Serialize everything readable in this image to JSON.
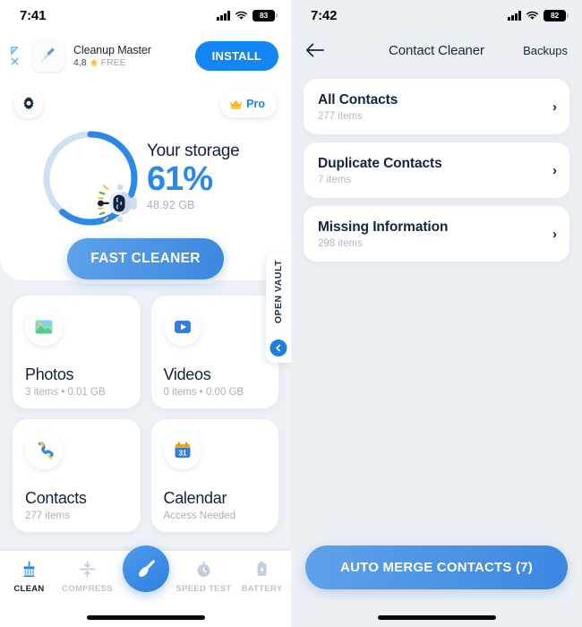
{
  "left": {
    "status": {
      "time": "7:41",
      "battery": "83",
      "signal_icon": "signal-bars-icon",
      "wifi_icon": "wifi-icon"
    },
    "ad": {
      "adchoices_icon": "adchoices-triangle-icon",
      "close_icon": "close-x-icon",
      "app_icon": "broom-app-icon",
      "title": "Cleanup Master",
      "rating": "4.8",
      "star_icon": "star-icon",
      "price": "FREE",
      "install_label": "INSTALL"
    },
    "header": {
      "gear_icon": "gear-icon",
      "crown_icon": "crown-icon",
      "pro_label": "Pro"
    },
    "storage": {
      "title": "Your storage",
      "percent_label": "61%",
      "percent_value": 61,
      "size_label": "48.92 GB",
      "mascot_icon": "robot-mascot-icon",
      "ring_track_color": "#cfe0f5",
      "ring_fill_color": "#2b87e8"
    },
    "fast_cleaner_label": "FAST CLEANER",
    "vault": {
      "label": "OPEN VAULT",
      "arrow_icon": "chevron-left-icon"
    },
    "tiles": [
      {
        "name": "Photos",
        "sub": "3 items • 0.01 GB",
        "icon": "photo-icon"
      },
      {
        "name": "Videos",
        "sub": "0 items • 0.00 GB",
        "icon": "video-play-icon"
      },
      {
        "name": "Contacts",
        "sub": "277 items",
        "icon": "telephone-icon"
      },
      {
        "name": "Calendar",
        "sub": "Access Needed",
        "icon": "calendar-icon"
      }
    ],
    "tabs": [
      {
        "label": "CLEAN",
        "icon": "broom-icon",
        "active": true
      },
      {
        "label": "COMPRESS",
        "icon": "compress-icon",
        "active": false
      },
      {
        "label": "SPEED TEST",
        "icon": "stopwatch-icon",
        "active": false
      },
      {
        "label": "BATTERY",
        "icon": "battery-bolt-icon",
        "active": false
      }
    ],
    "fab_icon": "broom-fab-icon"
  },
  "right": {
    "status": {
      "time": "7:42",
      "battery": "82",
      "signal_icon": "signal-bars-icon",
      "wifi_icon": "wifi-icon"
    },
    "nav": {
      "back_icon": "arrow-left-icon",
      "title": "Contact Cleaner",
      "action_label": "Backups"
    },
    "rows": [
      {
        "title": "All Contacts",
        "sub": "277 items",
        "chevron": "›"
      },
      {
        "title": "Duplicate Contacts",
        "sub": "7 items",
        "chevron": "›"
      },
      {
        "title": "Missing Information",
        "sub": "298 items",
        "chevron": "›"
      }
    ],
    "merge_label": "AUTO MERGE CONTACTS (7)"
  }
}
